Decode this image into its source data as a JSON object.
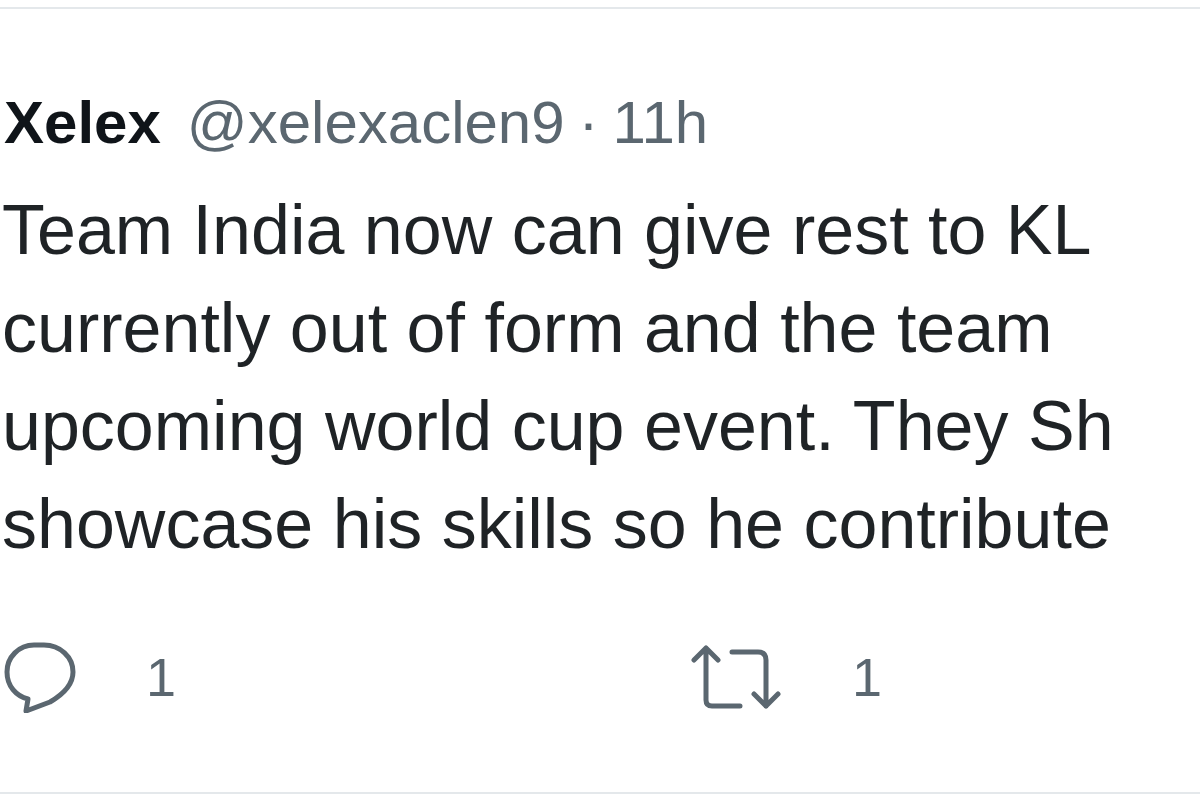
{
  "tweet": {
    "author": {
      "name": "Xelex",
      "handle": "@xelexaclen9",
      "separator": "·",
      "time": "11h"
    },
    "text_lines": [
      "Team India now can give rest to KL",
      "currently out of form and the team",
      "upcoming world cup event. They Sh",
      "showcase his skills so he contribute"
    ],
    "actions": [
      {
        "kind": "reply",
        "count": "1"
      },
      {
        "kind": "retweet",
        "count": "1"
      }
    ]
  }
}
